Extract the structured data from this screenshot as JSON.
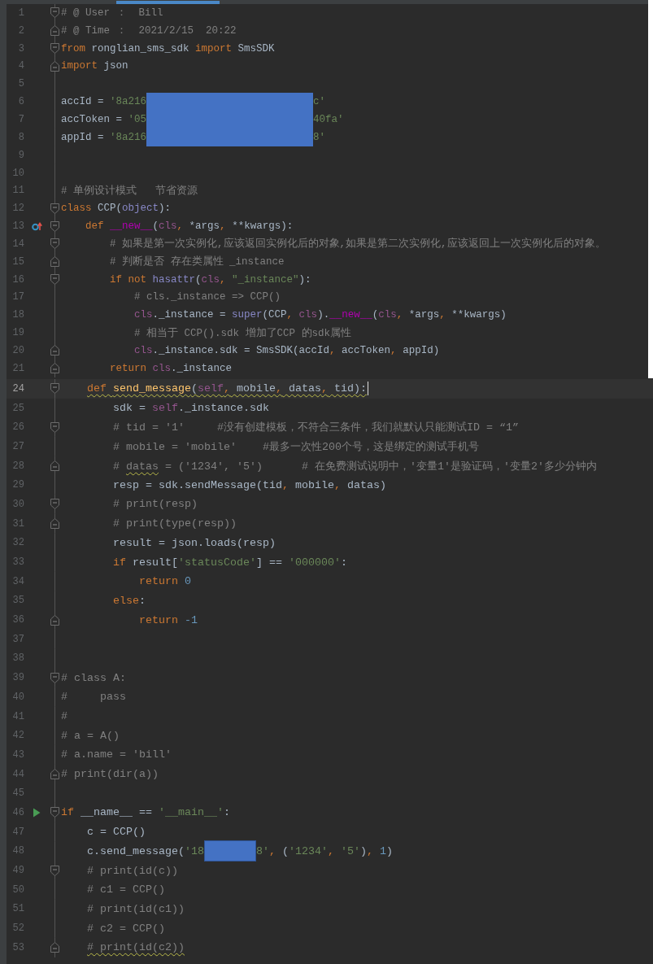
{
  "panels": [
    {
      "lines": [
        {
          "number": "1",
          "fold": {
            "kind": "start"
          },
          "tokens": [
            {
              "text": "# @ User ：  Bill",
              "kind": "comment",
              "squiggle": false
            }
          ]
        },
        {
          "number": "2",
          "fold": {
            "kind": "end"
          },
          "tokens": [
            {
              "text": "# @ Time ：  2021/2/15  20:22",
              "kind": "comment",
              "squiggle": false
            }
          ]
        },
        {
          "number": "3",
          "fold": {
            "kind": "start"
          },
          "tokens": [
            {
              "text": "from",
              "kind": "keyword",
              "squiggle": false
            },
            {
              "text": " ronglian_sms_sdk ",
              "kind": "plain",
              "squiggle": false
            },
            {
              "text": "import",
              "kind": "keyword",
              "squiggle": false
            },
            {
              "text": " SmsSDK",
              "kind": "plain",
              "squiggle": false
            }
          ]
        },
        {
          "number": "4",
          "fold": {
            "kind": "end"
          },
          "tokens": [
            {
              "text": "import",
              "kind": "keyword",
              "squiggle": false
            },
            {
              "text": " json",
              "kind": "plain",
              "squiggle": false
            }
          ]
        },
        {
          "number": "5"
        },
        {
          "number": "6",
          "tokens": [
            {
              "text": "accId = ",
              "kind": "plain",
              "squiggle": false
            },
            {
              "text": "'8a216",
              "kind": "string",
              "squiggle": false
            },
            {
              "kind": "redaction",
              "extent": {
                "kind": "wide"
              }
            },
            {
              "text": "c'",
              "kind": "string",
              "squiggle": false
            }
          ]
        },
        {
          "number": "7",
          "tokens": [
            {
              "text": "accToken = ",
              "kind": "plain",
              "squiggle": false
            },
            {
              "text": "'05",
              "kind": "string",
              "squiggle": false
            },
            {
              "kind": "redaction",
              "extent": {
                "kind": "wide"
              }
            },
            {
              "text": "40fa'",
              "kind": "string",
              "squiggle": false
            }
          ]
        },
        {
          "number": "8",
          "tokens": [
            {
              "text": "appId = ",
              "kind": "plain",
              "squiggle": false
            },
            {
              "text": "'8a216",
              "kind": "string",
              "squiggle": false
            },
            {
              "kind": "redaction",
              "extent": {
                "kind": "wide"
              }
            },
            {
              "text": "8'",
              "kind": "string",
              "squiggle": false
            }
          ]
        },
        {
          "number": "9"
        },
        {
          "number": "10"
        },
        {
          "number": "11",
          "tokens": [
            {
              "text": "# 单例设计模式   节省资源",
              "kind": "comment",
              "squiggle": false
            }
          ]
        },
        {
          "number": "12",
          "fold": {
            "kind": "start"
          },
          "tokens": [
            {
              "text": "class",
              "kind": "keyword",
              "squiggle": false
            },
            {
              "text": " CCP(",
              "kind": "plain",
              "squiggle": false
            },
            {
              "text": "object",
              "kind": "builtin",
              "squiggle": false
            },
            {
              "text": "):",
              "kind": "plain",
              "squiggle": false
            }
          ]
        },
        {
          "number": "13",
          "fold": {
            "kind": "start"
          },
          "marker": {
            "kind": "override"
          },
          "tokens": [
            {
              "text": "    def ",
              "kind": "keyword",
              "squiggle": false
            },
            {
              "text": "__new__",
              "kind": "magic",
              "squiggle": false
            },
            {
              "text": "(",
              "kind": "plain",
              "squiggle": false
            },
            {
              "text": "cls",
              "kind": "self",
              "squiggle": false
            },
            {
              "text": ",",
              "kind": "keyword",
              "squiggle": false
            },
            {
              "text": " *args",
              "kind": "plain",
              "squiggle": false
            },
            {
              "text": ",",
              "kind": "keyword",
              "squiggle": false
            },
            {
              "text": " **kwargs):",
              "kind": "plain",
              "squiggle": false
            }
          ]
        },
        {
          "number": "14",
          "fold": {
            "kind": "start"
          },
          "tokens": [
            {
              "text": "        # 如果是第一次实例化,应该返回实例化后的对象,如果是第二次实例化,应该返回上一次实例化后的对象。",
              "kind": "comment",
              "squiggle": false
            }
          ]
        },
        {
          "number": "15",
          "fold": {
            "kind": "end"
          },
          "tokens": [
            {
              "text": "        # 判断是否 存在类属性 _instance",
              "kind": "comment",
              "squiggle": false
            }
          ]
        },
        {
          "number": "16",
          "fold": {
            "kind": "start"
          },
          "tokens": [
            {
              "text": "        if not ",
              "kind": "keyword",
              "squiggle": false
            },
            {
              "text": "hasattr",
              "kind": "builtin",
              "squiggle": false
            },
            {
              "text": "(",
              "kind": "plain",
              "squiggle": false
            },
            {
              "text": "cls",
              "kind": "self",
              "squiggle": false
            },
            {
              "text": ", ",
              "kind": "keyword",
              "squiggle": false
            },
            {
              "text": "\"_instance\"",
              "kind": "string",
              "squiggle": false
            },
            {
              "text": "):",
              "kind": "plain",
              "squiggle": false
            }
          ]
        },
        {
          "number": "17",
          "tokens": [
            {
              "text": "            # cls._instance => CCP()",
              "kind": "comment",
              "squiggle": false
            }
          ]
        },
        {
          "number": "18",
          "tokens": [
            {
              "text": "            cls",
              "kind": "self",
              "squiggle": false
            },
            {
              "text": "._instance = ",
              "kind": "plain",
              "squiggle": false
            },
            {
              "text": "super",
              "kind": "builtin",
              "squiggle": false
            },
            {
              "text": "(CCP",
              "kind": "plain",
              "squiggle": false
            },
            {
              "text": ", ",
              "kind": "keyword",
              "squiggle": false
            },
            {
              "text": "cls",
              "kind": "self",
              "squiggle": false
            },
            {
              "text": ").",
              "kind": "plain",
              "squiggle": false
            },
            {
              "text": "__new__",
              "kind": "magic",
              "squiggle": false
            },
            {
              "text": "(",
              "kind": "plain",
              "squiggle": false
            },
            {
              "text": "cls",
              "kind": "self",
              "squiggle": false
            },
            {
              "text": ",",
              "kind": "keyword",
              "squiggle": false
            },
            {
              "text": " *args",
              "kind": "plain",
              "squiggle": false
            },
            {
              "text": ",",
              "kind": "keyword",
              "squiggle": false
            },
            {
              "text": " **kwargs)",
              "kind": "plain",
              "squiggle": false
            }
          ]
        },
        {
          "number": "19",
          "tokens": [
            {
              "text": "            # 相当于 CCP().sdk 增加了CCP 的sdk属性",
              "kind": "comment",
              "squiggle": false
            }
          ]
        },
        {
          "number": "20",
          "fold": {
            "kind": "end"
          },
          "tokens": [
            {
              "text": "            cls",
              "kind": "self",
              "squiggle": false
            },
            {
              "text": "._instance.sdk = SmsSDK(accId",
              "kind": "plain",
              "squiggle": false
            },
            {
              "text": ",",
              "kind": "keyword",
              "squiggle": false
            },
            {
              "text": " accToken",
              "kind": "plain",
              "squiggle": false
            },
            {
              "text": ",",
              "kind": "keyword",
              "squiggle": false
            },
            {
              "text": " appId)",
              "kind": "plain",
              "squiggle": false
            }
          ]
        },
        {
          "number": "21",
          "fold": {
            "kind": "end"
          },
          "tokens": [
            {
              "text": "        return ",
              "kind": "keyword",
              "squiggle": false
            },
            {
              "text": "cls",
              "kind": "self",
              "squiggle": false
            },
            {
              "text": "._instance",
              "kind": "plain",
              "squiggle": false
            }
          ]
        }
      ]
    },
    {
      "lines": [
        {
          "number": "24",
          "fold": {
            "kind": "start"
          },
          "current": true,
          "tokens": [
            {
              "text": "    def ",
              "kind": "keyword",
              "squiggle": true
            },
            {
              "text": "send_message",
              "kind": "function",
              "squiggle": true
            },
            {
              "text": "(",
              "kind": "plain",
              "squiggle": true
            },
            {
              "text": "self",
              "kind": "self",
              "squiggle": true
            },
            {
              "text": ",",
              "kind": "keyword",
              "squiggle": true
            },
            {
              "text": " mobile",
              "kind": "plain",
              "squiggle": true
            },
            {
              "text": ",",
              "kind": "keyword",
              "squiggle": true
            },
            {
              "text": " datas",
              "kind": "plain",
              "squiggle": true
            },
            {
              "text": ",",
              "kind": "keyword",
              "squiggle": true
            },
            {
              "text": " tid):",
              "kind": "plain",
              "squiggle": true
            }
          ]
        },
        {
          "number": "25",
          "current": false,
          "tokens": [
            {
              "text": "        sdk = ",
              "kind": "plain",
              "squiggle": false
            },
            {
              "text": "self",
              "kind": "self",
              "squiggle": false
            },
            {
              "text": "._instance.sdk",
              "kind": "plain",
              "squiggle": false
            }
          ]
        },
        {
          "number": "26",
          "fold": {
            "kind": "start"
          },
          "current": false,
          "tokens": [
            {
              "text": "        # tid = '1'     #没有创建模板，不符合三条件，我们就默认只能测试ID = “1”",
              "kind": "comment",
              "squiggle": false
            }
          ]
        },
        {
          "number": "27",
          "current": false,
          "tokens": [
            {
              "text": "        # mobile = 'mobile'    #最多一次性200个号，这是绑定的测试手机号",
              "kind": "comment",
              "squiggle": false
            }
          ]
        },
        {
          "number": "28",
          "fold": {
            "kind": "end"
          },
          "current": false,
          "tokens": [
            {
              "text": "        # ",
              "kind": "comment",
              "squiggle": false
            },
            {
              "text": "datas",
              "kind": "comment",
              "squiggle": true
            },
            {
              "text": " = ('1234', '5')      # 在免费测试说明中，'变量1'是验证码，'变量2'多少分钟内",
              "kind": "comment",
              "squiggle": false
            }
          ]
        },
        {
          "number": "29",
          "current": false,
          "tokens": [
            {
              "text": "        resp = sdk.sendMessage(tid",
              "kind": "plain",
              "squiggle": false
            },
            {
              "text": ",",
              "kind": "keyword",
              "squiggle": false
            },
            {
              "text": " mobile",
              "kind": "plain",
              "squiggle": false
            },
            {
              "text": ",",
              "kind": "keyword",
              "squiggle": false
            },
            {
              "text": " datas)",
              "kind": "plain",
              "squiggle": false
            }
          ]
        },
        {
          "number": "30",
          "fold": {
            "kind": "start"
          },
          "current": false,
          "tokens": [
            {
              "text": "        # print(resp)",
              "kind": "comment",
              "squiggle": false
            }
          ]
        },
        {
          "number": "31",
          "fold": {
            "kind": "end"
          },
          "current": false,
          "tokens": [
            {
              "text": "        # print(type(resp))",
              "kind": "comment",
              "squiggle": false
            }
          ]
        },
        {
          "number": "32",
          "current": false,
          "tokens": [
            {
              "text": "        result = json.loads(resp)",
              "kind": "plain",
              "squiggle": false
            }
          ]
        },
        {
          "number": "33",
          "current": false,
          "tokens": [
            {
              "text": "        if ",
              "kind": "keyword",
              "squiggle": false
            },
            {
              "text": "result[",
              "kind": "plain",
              "squiggle": false
            },
            {
              "text": "'statusCode'",
              "kind": "string",
              "squiggle": false
            },
            {
              "text": "] == ",
              "kind": "plain",
              "squiggle": false
            },
            {
              "text": "'000000'",
              "kind": "string",
              "squiggle": false
            },
            {
              "text": ":",
              "kind": "plain",
              "squiggle": false
            }
          ]
        },
        {
          "number": "34",
          "current": false,
          "tokens": [
            {
              "text": "            return ",
              "kind": "keyword",
              "squiggle": false
            },
            {
              "text": "0",
              "kind": "number",
              "squiggle": false
            }
          ]
        },
        {
          "number": "35",
          "current": false,
          "tokens": [
            {
              "text": "        else",
              "kind": "keyword",
              "squiggle": false
            },
            {
              "text": ":",
              "kind": "plain",
              "squiggle": false
            }
          ]
        },
        {
          "number": "36",
          "fold": {
            "kind": "end"
          },
          "current": false,
          "tokens": [
            {
              "text": "            return ",
              "kind": "keyword",
              "squiggle": false
            },
            {
              "text": "-1",
              "kind": "number",
              "squiggle": false
            }
          ]
        },
        {
          "number": "37",
          "current": false
        },
        {
          "number": "38",
          "current": false
        },
        {
          "number": "39",
          "fold": {
            "kind": "start"
          },
          "current": false,
          "tokens": [
            {
              "text": "# class A:",
              "kind": "comment",
              "squiggle": false
            }
          ]
        },
        {
          "number": "40",
          "current": false,
          "tokens": [
            {
              "text": "#     pass",
              "kind": "comment",
              "squiggle": false
            }
          ]
        },
        {
          "number": "41",
          "current": false,
          "tokens": [
            {
              "text": "#",
              "kind": "comment",
              "squiggle": false
            }
          ]
        },
        {
          "number": "42",
          "current": false,
          "tokens": [
            {
              "text": "# a = A()",
              "kind": "comment",
              "squiggle": false
            }
          ]
        },
        {
          "number": "43",
          "current": false,
          "tokens": [
            {
              "text": "# a.name = 'bill'",
              "kind": "comment",
              "squiggle": false
            }
          ]
        },
        {
          "number": "44",
          "fold": {
            "kind": "end"
          },
          "current": false,
          "tokens": [
            {
              "text": "# print(dir(a))",
              "kind": "comment",
              "squiggle": false
            }
          ]
        },
        {
          "number": "45",
          "current": false
        },
        {
          "number": "46",
          "fold": {
            "kind": "start"
          },
          "marker": {
            "kind": "run"
          },
          "current": false,
          "tokens": [
            {
              "text": "if ",
              "kind": "keyword",
              "squiggle": false
            },
            {
              "text": "__name__ == ",
              "kind": "plain",
              "squiggle": false
            },
            {
              "text": "'__main__'",
              "kind": "string",
              "squiggle": false
            },
            {
              "text": ":",
              "kind": "plain",
              "squiggle": false
            }
          ]
        },
        {
          "number": "47",
          "current": false,
          "tokens": [
            {
              "text": "    c = CCP()",
              "kind": "plain",
              "squiggle": false
            }
          ]
        },
        {
          "number": "48",
          "current": false,
          "tokens": [
            {
              "text": "    c.send_message(",
              "kind": "plain",
              "squiggle": false
            },
            {
              "text": "'18",
              "kind": "string",
              "squiggle": false
            },
            {
              "kind": "redaction",
              "extent": {
                "kind": "narrow"
              }
            },
            {
              "text": "8'",
              "kind": "string",
              "squiggle": false
            },
            {
              "text": ",",
              "kind": "keyword",
              "squiggle": false
            },
            {
              "text": " (",
              "kind": "plain",
              "squiggle": false
            },
            {
              "text": "'1234'",
              "kind": "string",
              "squiggle": false
            },
            {
              "text": ", ",
              "kind": "keyword",
              "squiggle": false
            },
            {
              "text": "'5'",
              "kind": "string",
              "squiggle": false
            },
            {
              "text": ")",
              "kind": "plain",
              "squiggle": false
            },
            {
              "text": ", ",
              "kind": "keyword",
              "squiggle": false
            },
            {
              "text": "1",
              "kind": "number",
              "squiggle": false
            },
            {
              "text": ")",
              "kind": "plain",
              "squiggle": false
            }
          ]
        },
        {
          "number": "49",
          "fold": {
            "kind": "start"
          },
          "current": false,
          "tokens": [
            {
              "text": "    # print(id(c))",
              "kind": "comment",
              "squiggle": false
            }
          ]
        },
        {
          "number": "50",
          "current": false,
          "tokens": [
            {
              "text": "    # c1 = CCP()",
              "kind": "comment",
              "squiggle": false
            }
          ]
        },
        {
          "number": "51",
          "current": false,
          "tokens": [
            {
              "text": "    # print(id(c1))",
              "kind": "comment",
              "squiggle": false
            }
          ]
        },
        {
          "number": "52",
          "current": false,
          "tokens": [
            {
              "text": "    # c2 = CCP()",
              "kind": "comment",
              "squiggle": false
            }
          ]
        },
        {
          "number": "53",
          "fold": {
            "kind": "end"
          },
          "current": false,
          "tokens": [
            {
              "text": "    # print(id(c2))",
              "kind": "comment",
              "squiggle": true
            }
          ]
        }
      ]
    }
  ]
}
